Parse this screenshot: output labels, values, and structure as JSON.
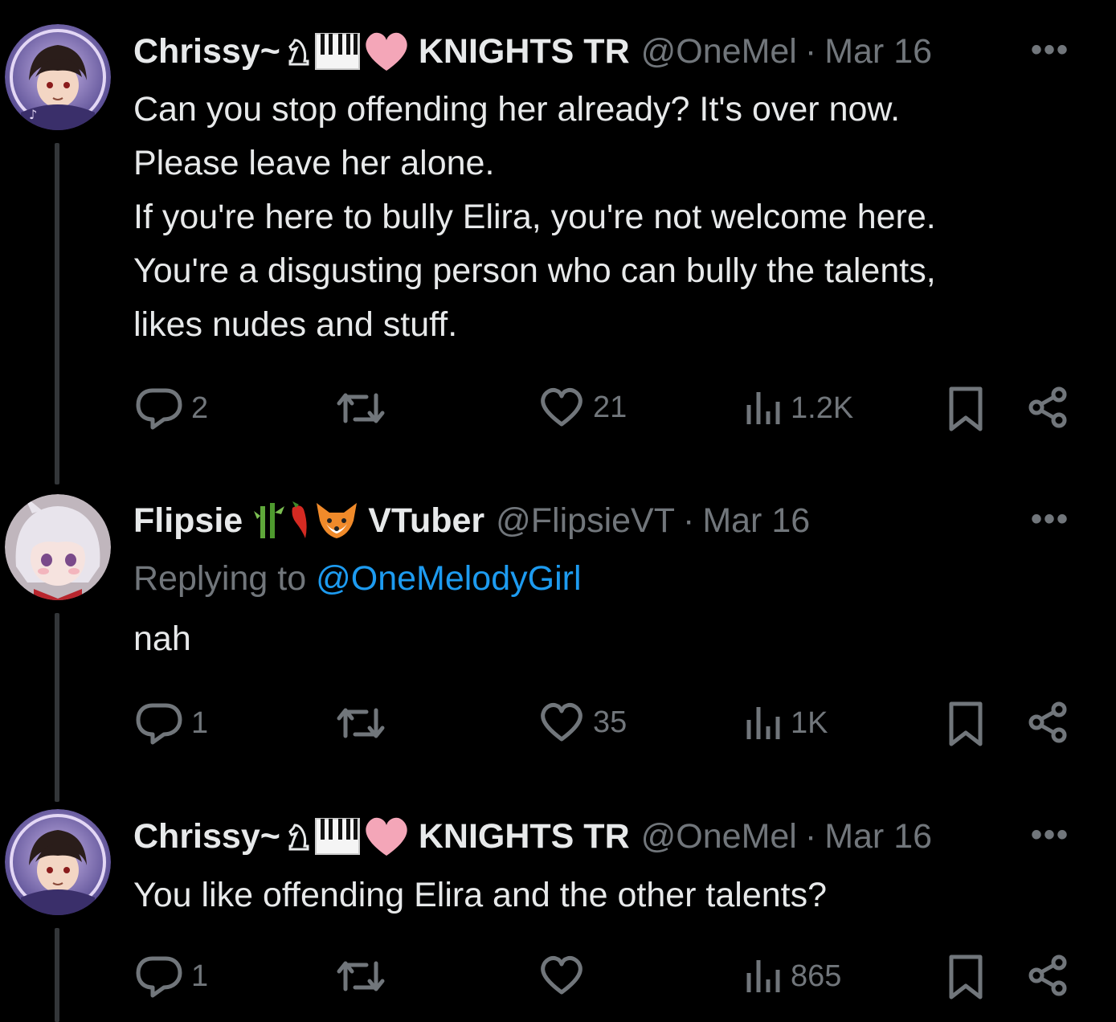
{
  "tweets": [
    {
      "name": "Chrissy~",
      "name_emoji": "♘🎹💗",
      "name_suffix": "KNIGHTS TR",
      "handle": "@OneMel",
      "separator": "·",
      "date": "Mar 16",
      "more": "•••",
      "lines": [
        "Can you stop offending her already? It's over now.",
        "Please leave her alone.",
        "If you're here to bully Elira, you're not welcome here.",
        "You're a disgusting person who can bully the talents,",
        "likes nudes and stuff."
      ],
      "replies": "2",
      "retweets": "",
      "likes": "21",
      "views": "1.2K"
    },
    {
      "name": "Flipsie",
      "name_emoji": "🎋🌶️🦊",
      "name_suffix": "VTuber",
      "handle": "@FlipsieVT",
      "separator": "·",
      "date": "Mar 16",
      "more": "•••",
      "replying_label": "Replying to",
      "replying_mention": "@OneMelodyGirl",
      "lines": [
        "nah"
      ],
      "replies": "1",
      "retweets": "",
      "likes": "35",
      "views": "1K"
    },
    {
      "name": "Chrissy~",
      "name_emoji": "♘🎹💗",
      "name_suffix": "KNIGHTS TR",
      "handle": "@OneMel",
      "separator": "·",
      "date": "Mar 16",
      "more": "•••",
      "lines": [
        "You like offending Elira and the other talents?"
      ],
      "replies": "1",
      "retweets": "",
      "likes": "",
      "views": "865"
    }
  ],
  "icons": {
    "reply": "speech-bubble-icon",
    "retweet": "retweet-icon",
    "like": "heart-icon",
    "views": "bar-chart-icon",
    "bookmark": "bookmark-icon",
    "share": "share-icon"
  },
  "colors": {
    "background": "#000000",
    "text": "#e7e9ea",
    "muted": "#71767b",
    "link": "#1d9bf0",
    "thread_line": "#333639"
  }
}
